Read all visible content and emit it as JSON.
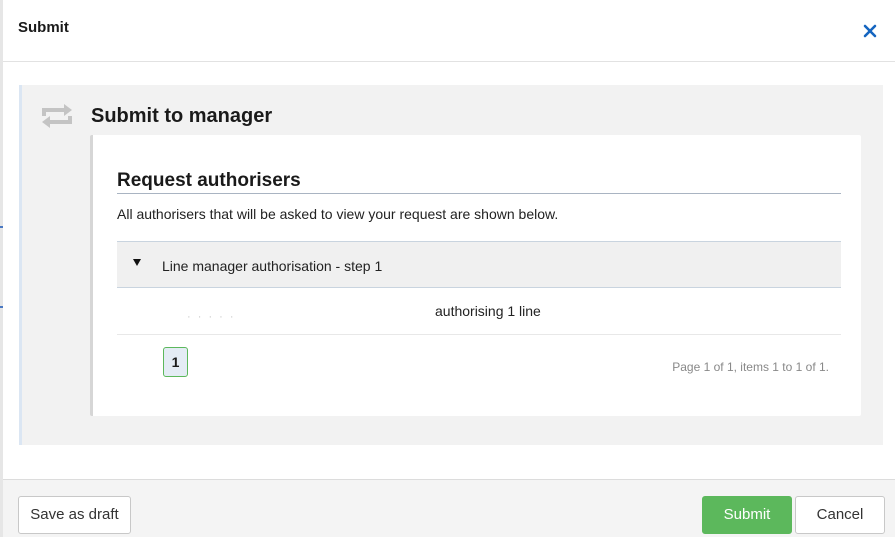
{
  "dialog": {
    "title": "Submit",
    "close_icon": "close-icon"
  },
  "submit_section": {
    "icon": "repeat-icon",
    "heading": "Submit to manager"
  },
  "authorisers": {
    "title": "Request authorisers",
    "description": "All authorisers that will be asked to view your request are shown below.",
    "group": {
      "expander_icon": "caret-down-icon",
      "label": "Line manager authorisation - step 1"
    },
    "rows": [
      {
        "name": "· · · · ·",
        "value": "authorising 1 line"
      }
    ],
    "pagination": {
      "current_page": "1",
      "summary": "Page 1 of 1, items 1 to 1 of 1."
    }
  },
  "footer": {
    "save_draft_label": "Save as draft",
    "submit_label": "Submit",
    "cancel_label": "Cancel"
  },
  "colors": {
    "submit_button": "#5cb85c",
    "close_icon": "#1565c0",
    "panel_background": "#f2f2f2"
  }
}
